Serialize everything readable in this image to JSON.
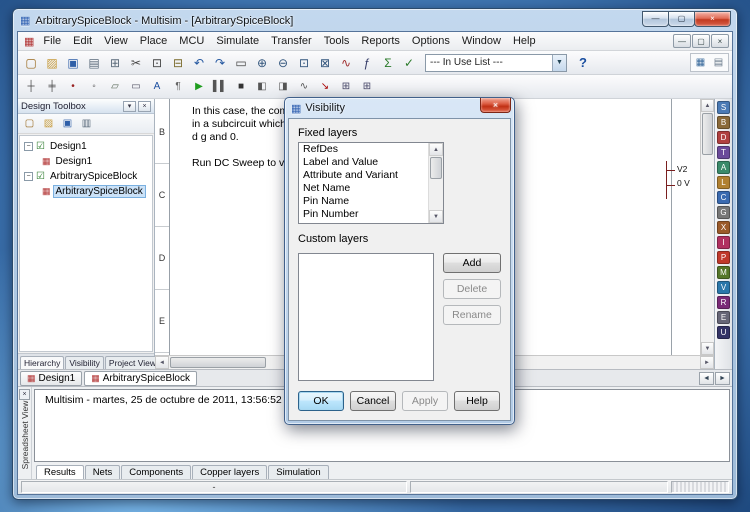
{
  "window": {
    "title": "ArbitrarySpiceBlock - Multisim - [ArbitrarySpiceBlock]",
    "controls": [
      "—",
      "▢",
      "×"
    ]
  },
  "menu": {
    "items": [
      {
        "name": "menu-file",
        "label": "File"
      },
      {
        "name": "menu-edit",
        "label": "Edit"
      },
      {
        "name": "menu-view",
        "label": "View"
      },
      {
        "name": "menu-place",
        "label": "Place"
      },
      {
        "name": "menu-mcu",
        "label": "MCU"
      },
      {
        "name": "menu-simulate",
        "label": "Simulate"
      },
      {
        "name": "menu-transfer",
        "label": "Transfer"
      },
      {
        "name": "menu-tools",
        "label": "Tools"
      },
      {
        "name": "menu-reports",
        "label": "Reports"
      },
      {
        "name": "menu-options",
        "label": "Options"
      },
      {
        "name": "menu-window",
        "label": "Window"
      },
      {
        "name": "menu-help",
        "label": "Help"
      }
    ],
    "mdi": [
      "—",
      "▢",
      "×"
    ]
  },
  "toolbar": {
    "in_use_list": "--- In Use List ---",
    "help_glyph": "?",
    "row1": [
      {
        "name": "new-file-icon",
        "glyph": "▢",
        "color": "#9a6a1f"
      },
      {
        "name": "open-file-icon",
        "glyph": "▨",
        "color": "#c79b3b"
      },
      {
        "name": "save-icon",
        "glyph": "▣",
        "color": "#2f5fa8"
      },
      {
        "name": "print-icon",
        "glyph": "▤",
        "color": "#5a6a7a"
      },
      {
        "name": "print-preview-icon",
        "glyph": "⊞",
        "color": "#5a6a7a"
      },
      {
        "name": "cut-icon",
        "glyph": "✂",
        "color": "#444444"
      },
      {
        "name": "copy-icon",
        "glyph": "⊡",
        "color": "#444444"
      },
      {
        "name": "paste-icon",
        "glyph": "⊟",
        "color": "#7a6a2a"
      },
      {
        "name": "undo-icon",
        "glyph": "↶",
        "color": "#2457a0"
      },
      {
        "name": "redo-icon",
        "glyph": "↷",
        "color": "#2457a0"
      },
      {
        "name": "fullscreen-icon",
        "glyph": "▭",
        "color": "#444444"
      },
      {
        "name": "zoom-in-icon",
        "glyph": "⊕",
        "color": "#33567d"
      },
      {
        "name": "zoom-out-icon",
        "glyph": "⊖",
        "color": "#33567d"
      },
      {
        "name": "zoom-area-icon",
        "glyph": "⊡",
        "color": "#33567d"
      },
      {
        "name": "zoom-fit-icon",
        "glyph": "⊠",
        "color": "#33567d"
      },
      {
        "name": "grapher-icon",
        "glyph": "∿",
        "color": "#a03030"
      },
      {
        "name": "analyses-icon",
        "glyph": "ƒ",
        "color": "#333a66"
      },
      {
        "name": "postprocessor-icon",
        "glyph": "Σ",
        "color": "#2a7a2a"
      },
      {
        "name": "erc-icon",
        "glyph": "✓",
        "color": "#2a7a2a"
      }
    ],
    "row2": [
      {
        "name": "place-wire-icon",
        "glyph": "┼",
        "color": "#444444"
      },
      {
        "name": "place-bus-icon",
        "glyph": "╪",
        "color": "#444444"
      },
      {
        "name": "place-junction-icon",
        "glyph": "•",
        "color": "#992222"
      },
      {
        "name": "connector-icon",
        "glyph": "◦",
        "color": "#444444"
      },
      {
        "name": "hierarchical-block-icon",
        "glyph": "▱",
        "color": "#556655"
      },
      {
        "name": "subcircuit-icon",
        "glyph": "▭",
        "color": "#555566"
      },
      {
        "name": "place-text-icon",
        "glyph": "A",
        "color": "#1b4fa0"
      },
      {
        "name": "description-box-icon",
        "glyph": "¶",
        "color": "#666666"
      },
      {
        "name": "run-simulation-icon",
        "glyph": "▶",
        "color": "#1f9d1f"
      },
      {
        "name": "pause-simulation-icon",
        "glyph": "▌▌",
        "color": "#555555"
      },
      {
        "name": "stop-simulation-icon",
        "glyph": "■",
        "color": "#333333"
      },
      {
        "name": "multimeter-icon",
        "glyph": "◧",
        "color": "#555555"
      },
      {
        "name": "oscilloscope-icon",
        "glyph": "◨",
        "color": "#555555"
      },
      {
        "name": "function-generator-icon",
        "glyph": "∿",
        "color": "#555555"
      },
      {
        "name": "probe-icon",
        "glyph": "↘",
        "color": "#aa0000"
      },
      {
        "name": "grid-icon",
        "glyph": "⊞",
        "color": "#444466"
      },
      {
        "name": "grid-properties-icon",
        "glyph": "⊞",
        "color": "#444466"
      }
    ]
  },
  "palette": [
    {
      "name": "source-components-icon",
      "glyph": "S",
      "bg": "#4a7ab5"
    },
    {
      "name": "basic-components-icon",
      "glyph": "B",
      "bg": "#8a6a3a"
    },
    {
      "name": "diode-components-icon",
      "glyph": "D",
      "bg": "#b04040"
    },
    {
      "name": "transistor-components-icon",
      "glyph": "T",
      "bg": "#6a4a9a"
    },
    {
      "name": "analog-components-icon",
      "glyph": "A",
      "bg": "#3a8a6a"
    },
    {
      "name": "ttl-components-icon",
      "glyph": "L",
      "bg": "#b08030"
    },
    {
      "name": "cmos-components-icon",
      "glyph": "C",
      "bg": "#3a6ab0"
    },
    {
      "name": "misc-digital-components-icon",
      "glyph": "G",
      "bg": "#777777"
    },
    {
      "name": "mixed-components-icon",
      "glyph": "X",
      "bg": "#9a5a2a"
    },
    {
      "name": "indicator-components-icon",
      "glyph": "I",
      "bg": "#b03060"
    },
    {
      "name": "power-components-icon",
      "glyph": "P",
      "bg": "#c0392b"
    },
    {
      "name": "misc-components-icon",
      "glyph": "M",
      "bg": "#55772a"
    },
    {
      "name": "peripherals-components-icon",
      "glyph": "V",
      "bg": "#2a77aa"
    },
    {
      "name": "rf-components-icon",
      "glyph": "R",
      "bg": "#7a2a77"
    },
    {
      "name": "electromechanical-components-icon",
      "glyph": "E",
      "bg": "#666677"
    },
    {
      "name": "mcu-components-icon",
      "glyph": "U",
      "bg": "#333366"
    }
  ],
  "design_toolbox": {
    "title": "Design Toolbox",
    "icons": [
      {
        "name": "toolbox-new-icon",
        "glyph": "▢",
        "color": "#9a6a1f"
      },
      {
        "name": "toolbox-open-icon",
        "glyph": "▨",
        "color": "#c79b3b"
      },
      {
        "name": "toolbox-save-icon",
        "glyph": "▣",
        "color": "#2f5fa8"
      },
      {
        "name": "toolbox-layers-icon",
        "glyph": "▥",
        "color": "#556677"
      }
    ],
    "tree": [
      "Design1",
      "Design1",
      "ArbitrarySpiceBlock",
      "ArbitrarySpiceBlock"
    ],
    "tabs": [
      "Hierarchy",
      "Visibility",
      "Project View"
    ]
  },
  "canvas": {
    "ruler_letters": [
      "B",
      "C",
      "D",
      "E"
    ],
    "lines": [
      "In this case, the component contains a MOSFET wrapped",
      "in a subcircuit which is conne",
      "d g and 0.",
      "",
      "Run DC Sweep to view the IV"
    ],
    "source_ref": "V2",
    "source_value": "0 V"
  },
  "doc_tabs": [
    "Design1",
    "ArbitrarySpiceBlock"
  ],
  "dialog": {
    "title": "Visibility",
    "fixed_layers_label": "Fixed layers",
    "fixed_layers": [
      "RefDes",
      "Label and Value",
      "Attribute and Variant",
      "Net Name",
      "Pin Name",
      "Pin Number"
    ],
    "custom_layers_label": "Custom layers",
    "add_label": "Add",
    "delete_label": "Delete",
    "rename_label": "Rename",
    "ok_label": "OK",
    "cancel_label": "Cancel",
    "apply_label": "Apply",
    "help_label": "Help"
  },
  "spreadsheet": {
    "label": "Spreadsheet View",
    "message": "Multisim  -  martes, 25 de octubre de 2011, 13:56:52",
    "tabs": [
      "Results",
      "Nets",
      "Components",
      "Copper layers",
      "Simulation"
    ]
  },
  "status": {
    "dash": "-"
  },
  "icons": {
    "app": "▦",
    "doc": "▦",
    "expander": "−",
    "check": "☑",
    "page": "▦",
    "up": "▲",
    "down": "▼",
    "left": "◄",
    "right": "►",
    "menu_down": "▾",
    "close_small": "×",
    "toolbox_toggle": "▦",
    "spreadsheet_toggle": "▤",
    "combo_arrow": "▼"
  },
  "colors": {
    "selection": "#cbe2f8",
    "wire": "#7a1f1f",
    "close_button": "#c23a20"
  }
}
